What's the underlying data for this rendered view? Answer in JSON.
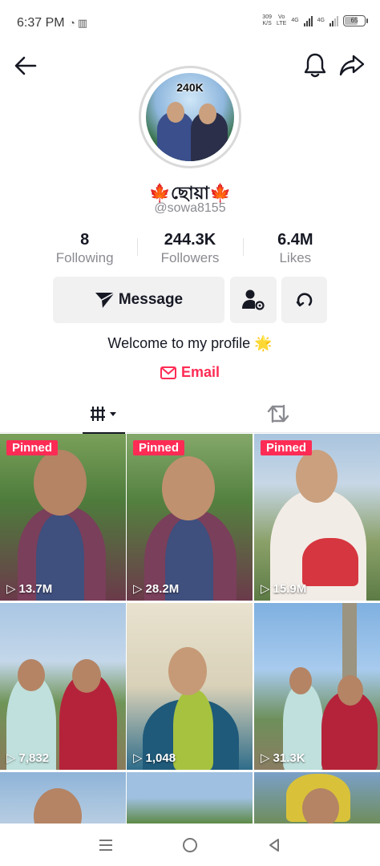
{
  "status_bar": {
    "time": "6:37 PM",
    "speed": "309",
    "speed_unit": "K/S",
    "net1": "Vo",
    "net1_sub": "LTE",
    "net2": "4G",
    "net3": "4G",
    "battery": "65"
  },
  "header": {
    "back_icon": "arrow-left-icon",
    "bell_icon": "bell-icon",
    "share_icon": "share-arrow-icon"
  },
  "profile": {
    "avatar_badge": "240K",
    "display_name": "🍁ছোয়া🍁",
    "username": "@sowa8155",
    "bio": "Welcome to my profile 🌟",
    "email_label": "Email"
  },
  "stats": [
    {
      "value": "8",
      "label": "Following"
    },
    {
      "value": "244.3K",
      "label": "Followers"
    },
    {
      "value": "6.4M",
      "label": "Likes"
    }
  ],
  "actions": {
    "message_label": "Message",
    "friends_icon": "user-settings-icon",
    "more_icon": "refresh-circle-icon"
  },
  "tabs": {
    "videos_icon": "grid-icon",
    "reposts_icon": "repost-icon"
  },
  "videos": [
    {
      "pinned": "Pinned",
      "views": "13.7M"
    },
    {
      "pinned": "Pinned",
      "views": "28.2M"
    },
    {
      "pinned": "Pinned",
      "views": "15.9M"
    },
    {
      "pinned": "",
      "views": "7,832"
    },
    {
      "pinned": "",
      "views": "1,048"
    },
    {
      "pinned": "",
      "views": "31.3K"
    },
    {
      "pinned": "",
      "views": ""
    },
    {
      "pinned": "",
      "views": ""
    },
    {
      "pinned": "",
      "views": ""
    }
  ],
  "colors": {
    "accent": "#fe2c55",
    "text": "#161823",
    "muted": "#8a8b91",
    "button_bg": "#f1f1f2"
  }
}
